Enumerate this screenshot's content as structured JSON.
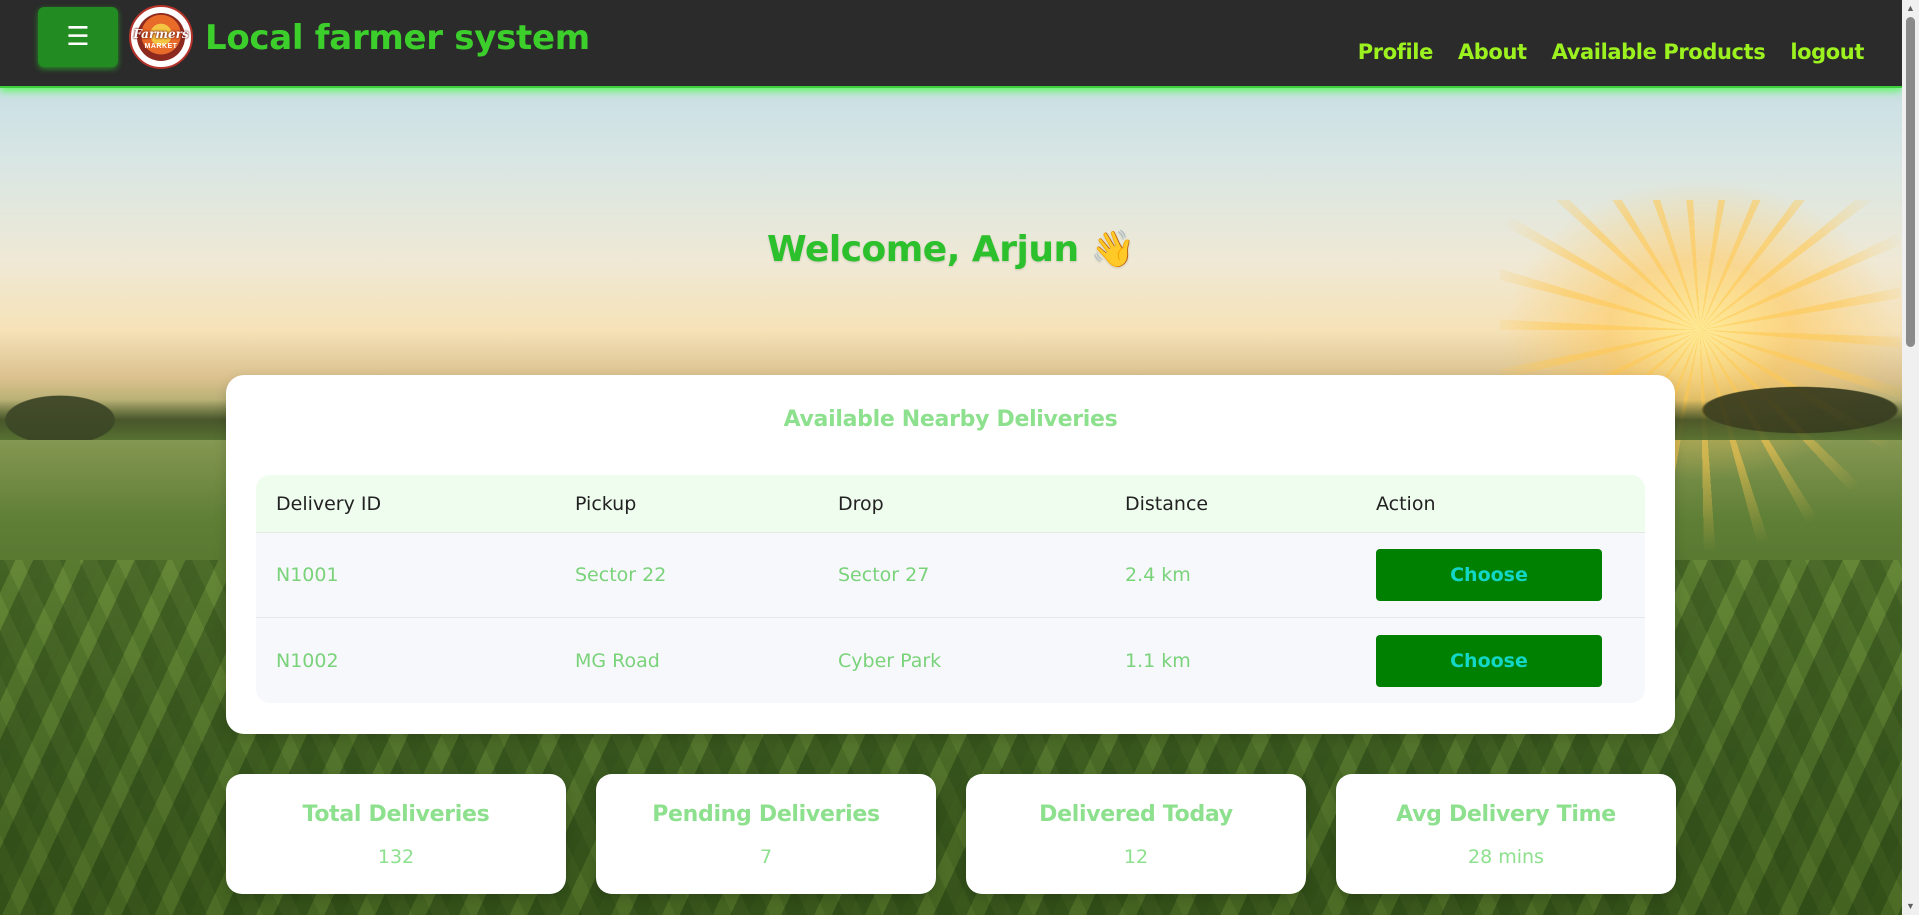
{
  "navbar": {
    "menu_icon": "☰",
    "logo_text": "Farmers",
    "logo_subtext": "MARKET",
    "title": "Local farmer system",
    "links": [
      {
        "label": "Profile"
      },
      {
        "label": "About"
      },
      {
        "label": "Available Products"
      },
      {
        "label": "logout"
      }
    ]
  },
  "welcome": {
    "text": "Welcome, Arjun",
    "emoji": "👋"
  },
  "deliveries": {
    "title": "Available Nearby Deliveries",
    "columns": [
      "Delivery ID",
      "Pickup",
      "Drop",
      "Distance",
      "Action"
    ],
    "rows": [
      {
        "id": "N1001",
        "pickup": "Sector 22",
        "drop": "Sector 27",
        "distance": "2.4 km",
        "action": "Choose"
      },
      {
        "id": "N1002",
        "pickup": "MG Road",
        "drop": "Cyber Park",
        "distance": "1.1 km",
        "action": "Choose"
      }
    ]
  },
  "stats": [
    {
      "label": "Total Deliveries",
      "value": "132"
    },
    {
      "label": "Pending Deliveries",
      "value": "7"
    },
    {
      "label": "Delivered Today",
      "value": "12"
    },
    {
      "label": "Avg Delivery Time",
      "value": "28 mins"
    }
  ],
  "icons": {
    "menu": "hamburger-menu-icon",
    "wave": "waving-hand-icon",
    "scroll_up": "▲",
    "scroll_down": "▼"
  },
  "colors": {
    "nav_bg": "#2b2b2b",
    "title_green": "#3ccf2c",
    "nav_link": "#9cf21f",
    "menu_btn": "#228b22",
    "choose_btn": "#008000",
    "choose_text": "#12d6c6",
    "soft_green_text": "#8de08d"
  }
}
